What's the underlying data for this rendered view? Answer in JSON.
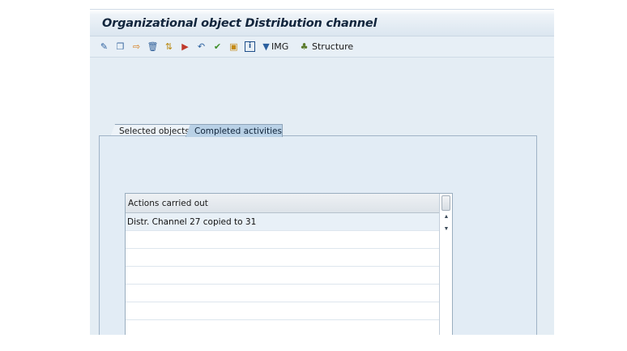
{
  "window": {
    "title": "Organizational object Distribution channel"
  },
  "toolbar": {
    "icons": [
      {
        "name": "display-change-icon",
        "glyph": "✎",
        "color": "#2a5f9e"
      },
      {
        "name": "copy-icon",
        "glyph": "❐",
        "color": "#3b6aa0"
      },
      {
        "name": "copy-object-icon",
        "glyph": "⇨",
        "color": "#d57a14"
      },
      {
        "name": "delete-icon",
        "glyph": "🗑",
        "color": "#2e5e98"
      },
      {
        "name": "relocate-icon",
        "glyph": "⇅",
        "color": "#b8860b"
      },
      {
        "name": "transport-icon",
        "glyph": "▶",
        "color": "#c0392b"
      },
      {
        "name": "undo-icon",
        "glyph": "↶",
        "color": "#2a5f9e"
      },
      {
        "name": "check-icon",
        "glyph": "✔",
        "color": "#3f8f2a"
      },
      {
        "name": "documentation-icon",
        "glyph": "▣",
        "color": "#c48a14"
      },
      {
        "name": "info-icon",
        "glyph": "i",
        "color": "#1f4f8a"
      },
      {
        "name": "img-filter-icon",
        "glyph": "▼",
        "color": "#2a5f9e"
      },
      {
        "name": "structure-icon",
        "glyph": "♣",
        "color": "#5a7a2a"
      }
    ],
    "img_label": "IMG",
    "structure_label": "Structure"
  },
  "tabs": [
    {
      "label": "Selected objects"
    },
    {
      "label": "Completed activities"
    }
  ],
  "table": {
    "header": "Actions carried out",
    "rows": [
      "Distr. Channel 27 copied to 31"
    ]
  }
}
